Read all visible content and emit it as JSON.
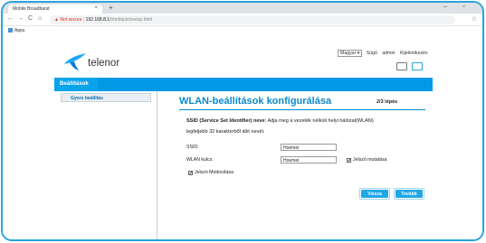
{
  "browser": {
    "tab_title": "Mobile Broadband",
    "tab_close": "×",
    "new_tab": "+",
    "not_secure": "Not secure",
    "url_host": "192.168.8.1",
    "url_path": "/html/quicksetup.html",
    "bookmark": "Apps"
  },
  "header": {
    "language": "Magyar ▾",
    "help": "Súgó",
    "user": "admin",
    "logout": "Kijelentkezés",
    "brand": "telenor"
  },
  "nav": {
    "tab": "Beállítások"
  },
  "sidebar": {
    "items": [
      {
        "label": "Gyors beállítás"
      }
    ]
  },
  "main": {
    "title": "WLAN-beállítások konfigurálása",
    "step": "2/3 lépés",
    "desc_bold": "SSID (Service Set Identifier) neve:",
    "desc_rest": " Adja meg a vezeték nélküli helyi hálózat(WLAN)",
    "desc_line2": "legfeljebb 32 karakterből álló nevét.",
    "ssid_label": "SSID:",
    "ssid_value": "Hoemei",
    "key_label": "WLAN kulcs:",
    "key_value": "Hoemei",
    "show_password": "Jelszó mutatása",
    "change_password": "Jelszó Módosítása",
    "back_button": "Vissza",
    "next_button": "Tovább"
  },
  "colors": {
    "accent": "#0099e5",
    "title": "#0a8ad0",
    "frame": "#2aa3dc"
  }
}
